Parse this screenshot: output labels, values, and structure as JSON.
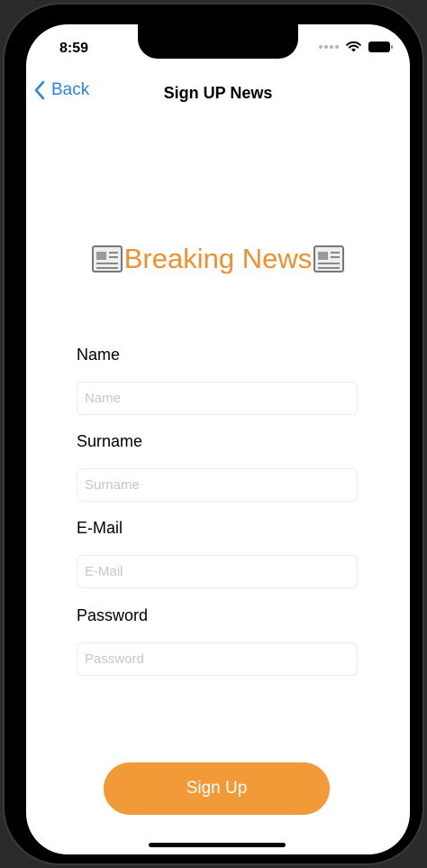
{
  "status_bar": {
    "time": "8:59",
    "icons": [
      "signal-icon",
      "wifi-icon",
      "battery-icon"
    ]
  },
  "nav": {
    "back_label": "Back",
    "title": "Sign UP News"
  },
  "headline": {
    "text": "Breaking News",
    "icon": "newspaper-icon",
    "color": "#ef8f2f"
  },
  "form": {
    "fields": [
      {
        "label": "Name",
        "placeholder": "Name",
        "value": ""
      },
      {
        "label": "Surname",
        "placeholder": "Surname",
        "value": ""
      },
      {
        "label": "E-Mail",
        "placeholder": "E-Mail",
        "value": ""
      },
      {
        "label": "Password",
        "placeholder": "Password",
        "value": ""
      }
    ]
  },
  "button": {
    "label": "Sign Up",
    "color": "#f29a38"
  },
  "colors": {
    "accent_blue": "#2f7ff0",
    "background": "#ffffff"
  }
}
